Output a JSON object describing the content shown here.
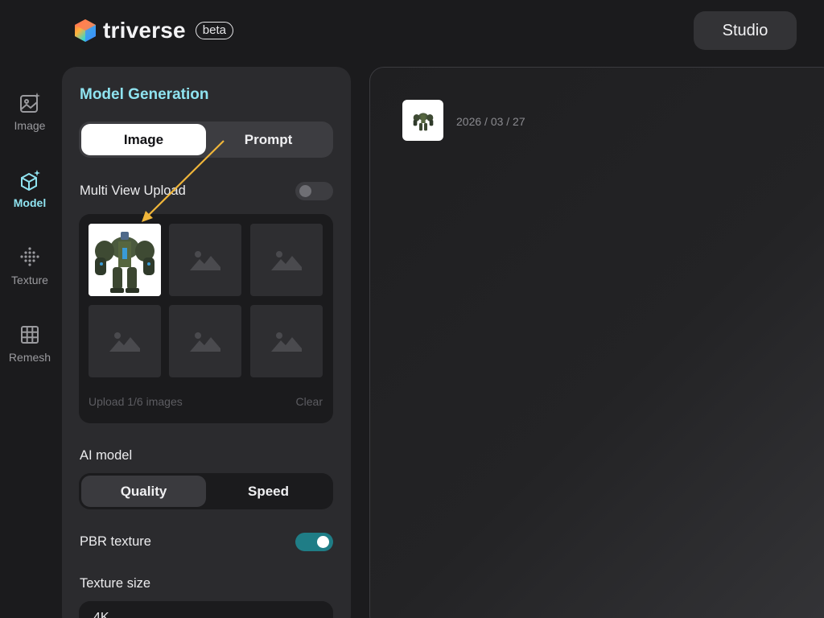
{
  "header": {
    "logo_text": "triverse",
    "badge": "beta",
    "studio_label": "Studio"
  },
  "rail": {
    "items": [
      {
        "label": "Image",
        "icon": "image-sparkle-icon",
        "active": false
      },
      {
        "label": "Model",
        "icon": "cube-sparkle-icon",
        "active": true
      },
      {
        "label": "Texture",
        "icon": "dot-grid-icon",
        "active": false
      },
      {
        "label": "Remesh",
        "icon": "mesh-grid-icon",
        "active": false
      }
    ]
  },
  "panel": {
    "title": "Model Generation",
    "input_tabs": {
      "image_label": "Image",
      "prompt_label": "Prompt",
      "selected": "Image"
    },
    "multi_view": {
      "label": "Multi View Upload",
      "enabled": false
    },
    "upload": {
      "count_text": "Upload 1/6 images",
      "clear_label": "Clear",
      "filled_slots": 1,
      "total_slots": 6
    },
    "ai_model": {
      "label": "AI model",
      "quality_label": "Quality",
      "speed_label": "Speed",
      "selected": "Quality"
    },
    "pbr": {
      "label": "PBR texture",
      "enabled": true
    },
    "texture_size": {
      "label": "Texture size",
      "value": "4K"
    }
  },
  "canvas": {
    "history": [
      {
        "date": "2026 / 03 / 27"
      }
    ]
  },
  "colors": {
    "accent": "#8fe3f0",
    "toggle_on": "#1f7d86",
    "annotation_arrow": "#f0b63a"
  }
}
